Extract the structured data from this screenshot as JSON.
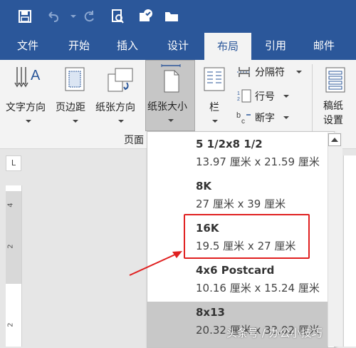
{
  "tabs": [
    "文件",
    "开始",
    "插入",
    "设计",
    "布局",
    "引用",
    "邮件"
  ],
  "active_tab": "布局",
  "ribbon": {
    "text_direction": "文字方向",
    "margins": "页边距",
    "orientation": "纸张方向",
    "size": "纸张大小",
    "columns": "栏",
    "breaks": "分隔符",
    "line_numbers": "行号",
    "hyphenation": "断字",
    "manuscript_line1": "稿纸",
    "manuscript_line2": "设置",
    "group_label": "页面"
  },
  "ruler_corner": "L",
  "ruler_numbers": [
    "4",
    "2",
    "2"
  ],
  "paper_sizes": [
    {
      "name": "5 1/2x8 1/2",
      "dims": "13.97 厘米 x 21.59 厘米"
    },
    {
      "name": "8K",
      "dims": "27 厘米 x 39 厘米"
    },
    {
      "name": "16K",
      "dims": "19.5 厘米 x 27 厘米"
    },
    {
      "name": "4x6 Postcard",
      "dims": "10.16 厘米 x 15.24 厘米"
    },
    {
      "name": "8x13",
      "dims": "20.32 厘米 x 33.02 厘米"
    }
  ],
  "watermark": "头条号 / 办公小技巧",
  "colors": {
    "accent": "#2b579a",
    "highlight": "#e02020",
    "selected_row": "#c8c8c8"
  }
}
